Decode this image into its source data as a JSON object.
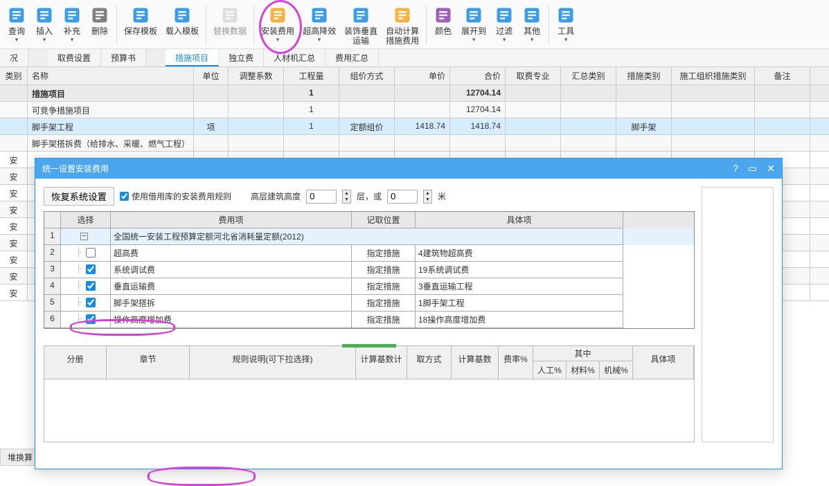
{
  "toolbar": {
    "items": [
      {
        "label": "查询",
        "icon": "#1a8ce0",
        "arrow": true
      },
      {
        "label": "插入",
        "icon": "#1a8ce0",
        "arrow": true
      },
      {
        "label": "补充",
        "icon": "#1a8ce0",
        "arrow": true
      },
      {
        "label": "删除",
        "icon": "#6b6b6b"
      },
      {
        "divider": true
      },
      {
        "label": "保存模板",
        "icon": "#1a8ce0"
      },
      {
        "label": "载入模板",
        "icon": "#1a8ce0"
      },
      {
        "divider": true
      },
      {
        "label": "替换数据",
        "icon": "#bbb",
        "disabled": true
      },
      {
        "divider": true
      },
      {
        "label": "安装费用",
        "icon": "#f5a623",
        "arrow": true,
        "circled": true
      },
      {
        "label": "超高降效",
        "icon": "#1a8ce0",
        "arrow": true
      },
      {
        "label": "装饰垂直\n运输",
        "icon": "#1a8ce0"
      },
      {
        "label": "自动计算\n措施费用",
        "icon": "#f5a623"
      },
      {
        "divider": true
      },
      {
        "label": "颜色",
        "icon": "#8e44ad"
      },
      {
        "label": "展开到",
        "icon": "#1a8ce0",
        "arrow": true
      },
      {
        "label": "过滤",
        "icon": "#1a8ce0",
        "arrow": true
      },
      {
        "label": "其他",
        "icon": "#1a8ce0",
        "arrow": true
      },
      {
        "divider": true
      },
      {
        "label": "工具",
        "icon": "#1a8ce0",
        "arrow": true
      }
    ]
  },
  "tabs": {
    "items": [
      "况",
      "取费设置",
      "预算书",
      "措施项目",
      "独立费",
      "人材机汇总",
      "费用汇总"
    ],
    "active_index": 3
  },
  "grid": {
    "headers": [
      "类别",
      "名称",
      "单位",
      "调整系数",
      "工程量",
      "组价方式",
      "单价",
      "合价",
      "取费专业",
      "汇总类别",
      "措施类别",
      "施工组织措施类别",
      "备注"
    ],
    "rows": [
      {
        "type": "",
        "name": "措施项目",
        "qty": "1",
        "total": "12704.14",
        "bold": true
      },
      {
        "type": "",
        "name": "可竞争措施项目",
        "qty": "1",
        "total": "12704.14"
      },
      {
        "type": "",
        "name": "脚手架工程",
        "unit": "项",
        "qty": "1",
        "method": "定额组价",
        "price": "1418.74",
        "total": "1418.74",
        "cat": "脚手架",
        "selected": true,
        "qty2": "1"
      },
      {
        "type": "",
        "name": "脚手架搭拆费（给排水、采暖、燃气工程）"
      },
      {
        "type": "安"
      },
      {
        "type": "安"
      },
      {
        "type": "安"
      },
      {
        "type": "安"
      },
      {
        "type": "安"
      },
      {
        "type": "安"
      },
      {
        "type": "安"
      },
      {
        "type": "安"
      },
      {
        "type": "安"
      }
    ]
  },
  "dialog": {
    "title": "统一设置安装费用",
    "restore_btn": "恢复系统设置",
    "use_rule_chk": "使用借用库的安装费用规则",
    "height_label": "高层建筑高度",
    "height_val1": "0",
    "floor_label": "层，或",
    "height_val2": "0",
    "unit_m": "米",
    "fee_headers": {
      "sel": "选择",
      "item": "费用项",
      "loc": "记取位置",
      "spec": "具体项"
    },
    "fee_rows": [
      {
        "idx": "1",
        "tree": true,
        "name": "全国统一安装工程预算定额河北省消耗量定额(2012)",
        "highlighted": true,
        "colspan": true
      },
      {
        "idx": "2",
        "checked": false,
        "name": "超高费",
        "loc": "指定措施",
        "spec": "4建筑物超高费"
      },
      {
        "idx": "3",
        "checked": true,
        "name": "系统调试费",
        "loc": "指定措施",
        "spec": "19系统调试费"
      },
      {
        "idx": "4",
        "checked": true,
        "name": "垂直运输费",
        "loc": "指定措施",
        "spec": "3垂直运输工程"
      },
      {
        "idx": "5",
        "checked": true,
        "name": "脚手架搭拆",
        "loc": "指定措施",
        "spec": "1脚手架工程"
      },
      {
        "idx": "6",
        "checked": true,
        "name": "操作高度增加费",
        "loc": "指定措施",
        "spec": "18操作高度增加费",
        "circled": true
      }
    ],
    "rule_headers": {
      "vol": "分册",
      "chap": "章节",
      "desc": "规则说明(可下拉选择)",
      "base": "计算基数计",
      "method": "取方式",
      "calc": "计算基数",
      "rate": "费率%",
      "subgroup": "其中",
      "sub1": "人工%",
      "sub2": "材料%",
      "sub3": "机械%",
      "spec": "具体项"
    }
  },
  "bottom": {
    "label": "堆换算",
    "arrow": "»"
  }
}
